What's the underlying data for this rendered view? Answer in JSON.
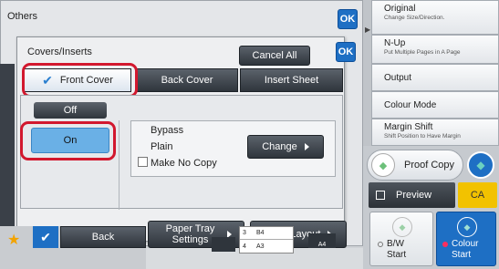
{
  "others": {
    "title": "Others",
    "ok": "OK"
  },
  "dialog": {
    "title": "Covers/Inserts",
    "cancel_all": "Cancel All",
    "ok": "OK"
  },
  "tabs": [
    {
      "label": "Front Cover"
    },
    {
      "label": "Back Cover"
    },
    {
      "label": "Insert Sheet"
    }
  ],
  "toggle": {
    "off": "Off",
    "on": "On"
  },
  "paper": {
    "tray": "Bypass",
    "type": "Plain",
    "no_copy": "Make No Copy",
    "change": "Change"
  },
  "bottom": {
    "paper_tray": "Paper Tray Settings",
    "page_layout": "Page Layout"
  },
  "footer": {
    "back": "Back"
  },
  "sidebar": [
    {
      "title": "Original",
      "sub": "Change Size/Direction."
    },
    {
      "title": "N-Up",
      "sub": "Put Multiple Pages in A Page"
    },
    {
      "title": "Output"
    },
    {
      "title": "Colour Mode"
    },
    {
      "title": "Margin Shift",
      "sub": "Shift Position to Have Margin"
    }
  ],
  "actions": {
    "proof_copy": "Proof Copy",
    "preview": "Preview",
    "ca": "CA",
    "bw": "B/W",
    "bw_start": "Start",
    "colour": "Colour",
    "colour_start": "Start"
  },
  "trays": [
    {
      "num": "3",
      "size": "B4"
    },
    {
      "num": "4",
      "size": "A3"
    }
  ],
  "tray_a4": "A4",
  "colors": {
    "accent": "#1e6fc4",
    "highlight": "#d2182e",
    "ca": "#f2c200",
    "on_btn": "#6ab0e6"
  }
}
